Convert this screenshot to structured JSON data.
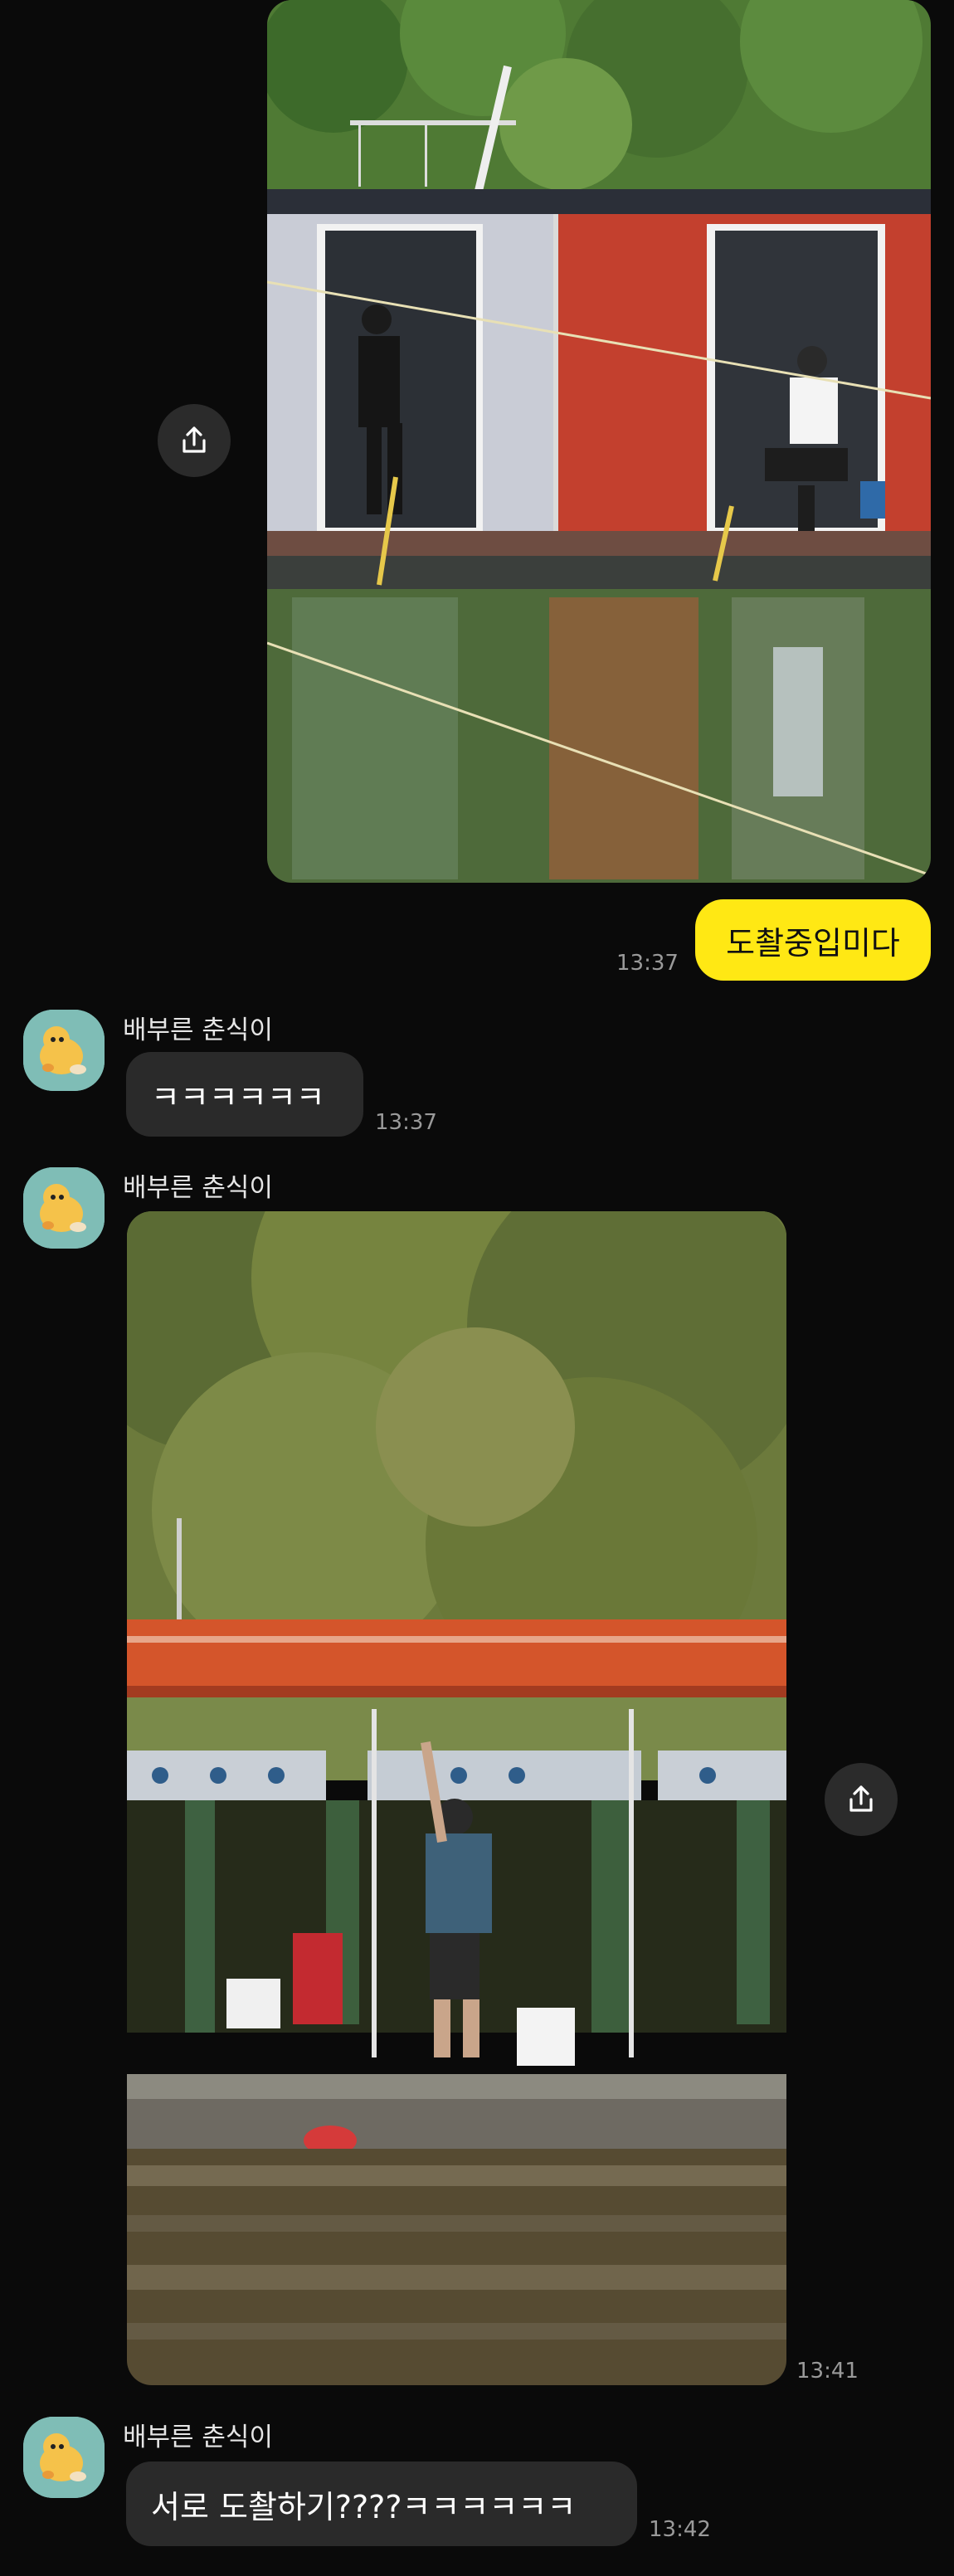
{
  "messages": [
    {
      "type": "photo",
      "sender": "me",
      "time": "13:37"
    },
    {
      "type": "text",
      "sender": "me",
      "text": "도촬중입미다",
      "time": "13:37"
    },
    {
      "type": "text",
      "sender": "배부른 춘식이",
      "text": "ㅋㅋㅋㅋㅋㅋ",
      "time": "13:37"
    },
    {
      "type": "photo",
      "sender": "배부른 춘식이",
      "time": "13:41"
    },
    {
      "type": "text",
      "sender": "배부른 춘식이",
      "text": "서로 도촬하기????ㅋㅋㅋㅋㅋㅋ",
      "time": "13:42"
    }
  ],
  "icons": {
    "share": "share-upload-icon",
    "avatar": "chunsik-character-avatar"
  },
  "colors": {
    "background": "#0a0a0a",
    "my_bubble": "#ffe814",
    "their_bubble": "#2a2a2a",
    "time": "#9a9a9a"
  }
}
